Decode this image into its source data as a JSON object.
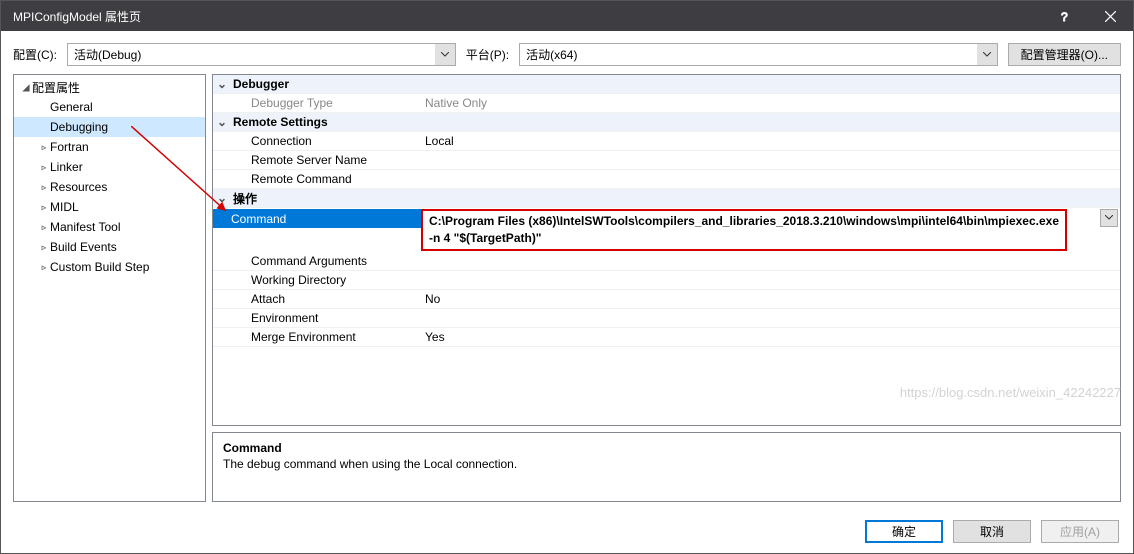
{
  "titlebar": {
    "title": "MPIConfigModel 属性页"
  },
  "topbar": {
    "config_label": "配置(C):",
    "config_value": "活动(Debug)",
    "platform_label": "平台(P):",
    "platform_value": "活动(x64)",
    "manager_label": "配置管理器(O)..."
  },
  "tree": {
    "root": "配置属性",
    "items": [
      {
        "label": "General",
        "exp": ""
      },
      {
        "label": "Debugging",
        "exp": "",
        "selected": true
      },
      {
        "label": "Fortran",
        "exp": "▹"
      },
      {
        "label": "Linker",
        "exp": "▹"
      },
      {
        "label": "Resources",
        "exp": "▹"
      },
      {
        "label": "MIDL",
        "exp": "▹"
      },
      {
        "label": "Manifest Tool",
        "exp": "▹"
      },
      {
        "label": "Build Events",
        "exp": "▹"
      },
      {
        "label": "Custom Build Step",
        "exp": "▹"
      }
    ]
  },
  "grid": {
    "group1": "Debugger",
    "debugger_type_label": "Debugger Type",
    "debugger_type_value": "Native Only",
    "group2": "Remote Settings",
    "connection_label": "Connection",
    "connection_value": "Local",
    "remote_server_label": "Remote Server Name",
    "remote_server_value": "",
    "remote_command_label": "Remote Command",
    "remote_command_value": "",
    "group3": "操作",
    "command_label": "Command",
    "command_value": "C:\\Program Files (x86)\\IntelSWTools\\compilers_and_libraries_2018.3.210\\windows\\mpi\\intel64\\bin\\mpiexec.exe",
    "command_args_label": "Command Arguments",
    "command_args_value": "-n 4 \"$(TargetPath)\"",
    "working_dir_label": "Working Directory",
    "working_dir_value": "",
    "attach_label": "Attach",
    "attach_value": "No",
    "env_label": "Environment",
    "env_value": "",
    "merge_env_label": "Merge Environment",
    "merge_env_value": "Yes"
  },
  "help": {
    "name": "Command",
    "desc": "The debug command when using the Local connection."
  },
  "footer": {
    "ok": "确定",
    "cancel": "取消",
    "apply": "应用(A)"
  },
  "watermark": "https://blog.csdn.net/weixin_42242227"
}
